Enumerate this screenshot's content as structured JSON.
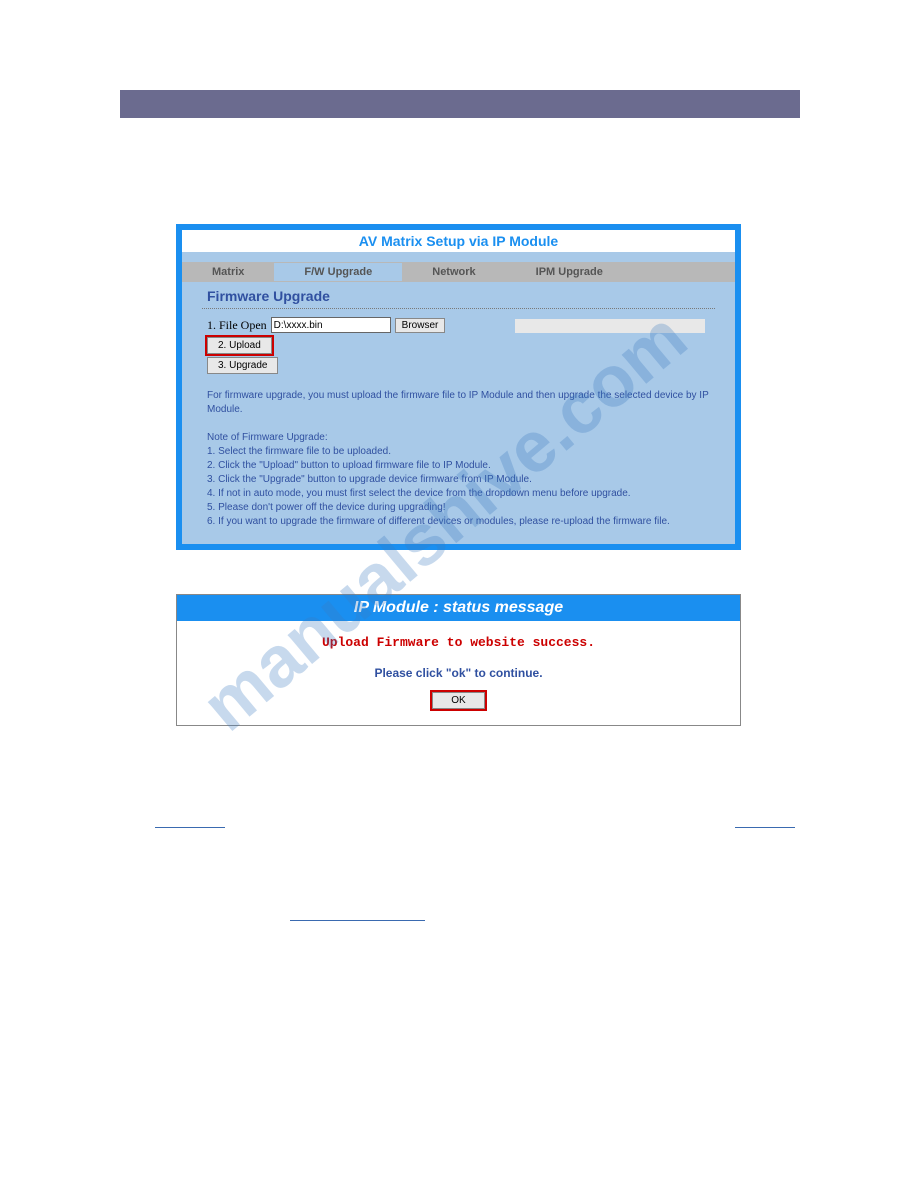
{
  "screenshot1": {
    "title": "AV Matrix Setup via IP Module",
    "tabs": [
      "Matrix",
      "F/W Upgrade",
      "Network",
      "IPM Upgrade"
    ],
    "section_title": "Firmware Upgrade",
    "file_open_label": "1. File Open",
    "file_value": "D:\\xxxx.bin",
    "browser_label": "Browser",
    "upload_label": "2. Upload",
    "upgrade_label": "3. Upgrade",
    "instruction_intro": "For firmware upgrade, you must upload the firmware file to IP Module and then upgrade the selected device by IP Module.",
    "note_title": "Note of Firmware Upgrade:",
    "notes": [
      "1. Select the firmware file to be uploaded.",
      "2. Click the \"Upload\" button to upload firmware file to IP Module.",
      "3. Click the \"Upgrade\" button to upgrade device firmware from IP Module.",
      "4. If not in auto mode, you must first select the device from the dropdown menu before upgrade.",
      "5. Please don't power off the device during upgrading!",
      "6. If you want to upgrade the firmware of different devices or modules, please re-upload the firmware file."
    ]
  },
  "screenshot2": {
    "title": "IP Module : status message",
    "message": "Upload Firmware to website success.",
    "instruction": "Please click \"ok\" to continue.",
    "ok_label": "OK"
  },
  "watermark": "manualshive.com"
}
